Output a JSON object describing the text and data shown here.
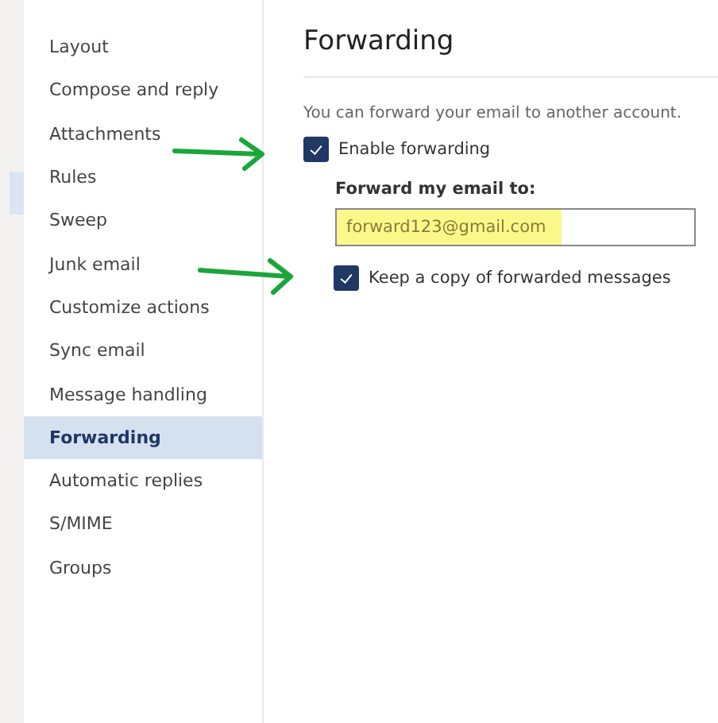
{
  "sidebar": {
    "items": [
      {
        "label": "Layout",
        "selected": false
      },
      {
        "label": "Compose and reply",
        "selected": false
      },
      {
        "label": "Attachments",
        "selected": false
      },
      {
        "label": "Rules",
        "selected": false
      },
      {
        "label": "Sweep",
        "selected": false
      },
      {
        "label": "Junk email",
        "selected": false
      },
      {
        "label": "Customize actions",
        "selected": false
      },
      {
        "label": "Sync email",
        "selected": false
      },
      {
        "label": "Message handling",
        "selected": false
      },
      {
        "label": "Forwarding",
        "selected": true
      },
      {
        "label": "Automatic replies",
        "selected": false
      },
      {
        "label": "S/MIME",
        "selected": false
      },
      {
        "label": "Groups",
        "selected": false
      }
    ]
  },
  "panel": {
    "title": "Forwarding",
    "description": "You can forward your email to another account.",
    "enable_forwarding": {
      "label": "Enable forwarding",
      "checked": true
    },
    "address_label": "Forward my email to:",
    "address_field": {
      "value": "forward123@gmail.com",
      "highlighted": true
    },
    "keep_copy": {
      "label": "Keep a copy of forwarded messages",
      "checked": true
    }
  },
  "annotations": [
    {
      "kind": "arrow"
    },
    {
      "kind": "arrow"
    }
  ]
}
